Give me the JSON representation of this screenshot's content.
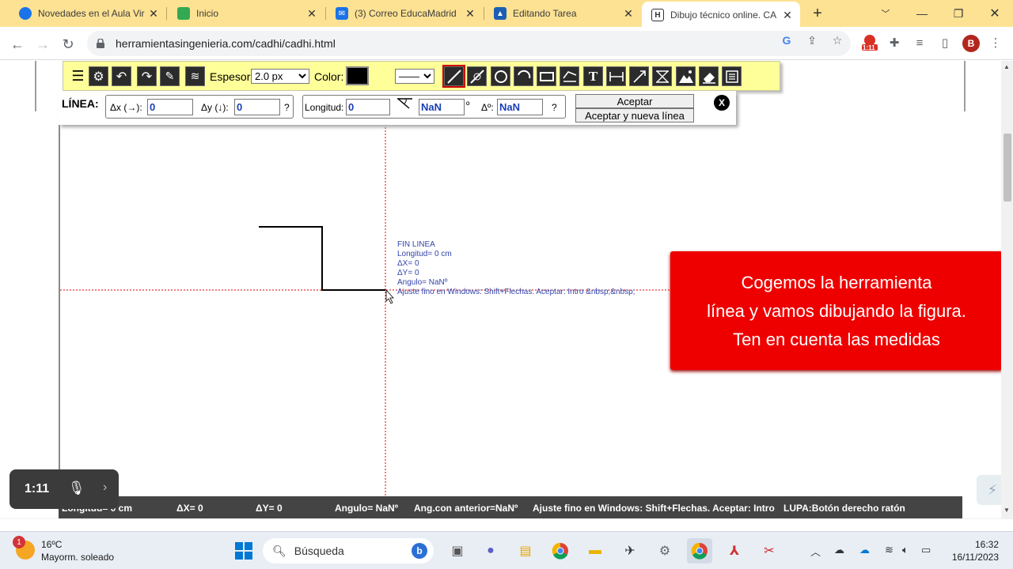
{
  "browser": {
    "tabs": [
      {
        "title": "Novedades en el Aula Vir",
        "favicon_color": "#1a73e8"
      },
      {
        "title": "Inicio",
        "favicon_color": "#34a853"
      },
      {
        "title": "(3) Correo EducaMadrid",
        "favicon_color": "#1a73e8"
      },
      {
        "title": "Editando Tarea",
        "favicon_color": "#1a5fb4"
      },
      {
        "title": "Dibujo técnico online. CA",
        "favicon_color": "#333333"
      }
    ],
    "url": "herramientasingenieria.com/cadhi/cadhi.html",
    "profile_initial": "B",
    "extension_badge": "1:11"
  },
  "cad_toolbar": {
    "grosor_label": "Espesor:",
    "grosor_value": "2.0 px",
    "color_label": "Color:",
    "color_value": "#000000",
    "linetype_value": "——"
  },
  "line_panel": {
    "title": "LÍNEA:",
    "dx_label": "Δx (→):",
    "dx_value": "0",
    "dy_label": "Δy (↓):",
    "dy_value": "0",
    "help": "?",
    "length_label": "Longitud:",
    "length_value": "0",
    "angle_value": "NaN",
    "degree_symbol": "º",
    "delta_angle_label": "Δº:",
    "delta_angle_value": "NaN",
    "accept_label": "Aceptar",
    "accept_new_label": "Aceptar y nueva línea",
    "close_label": "X"
  },
  "cursor_info": {
    "line1": "FIN LINEA",
    "line2": "Longitud= 0 cm",
    "line3": "ΔX= 0",
    "line4": "ΔY= 0",
    "line5": "Angulo= NaNº",
    "line6": "Ajuste fino en Windows: Shift+Flechas. Aceptar: Intro   &nbsp;&nbsp;"
  },
  "callout": {
    "line1": "Cogemos la herramienta",
    "line2": "línea y vamos dibujando la figura.",
    "line3": "Ten en cuenta las medidas",
    "color": "#ee0000"
  },
  "status_bar": {
    "length": "Longitud= 0 cm",
    "dx": "ΔX= 0",
    "dy": "ΔY= 0",
    "angle": "Angulo= NaNº",
    "prev_angle": "Ang.con anterior=NaNº",
    "hint": "Ajuste fino en Windows: Shift+Flechas. Aceptar: Intro",
    "lupa": "LUPA:Botón derecho ratón"
  },
  "video_overlay": {
    "time": "1:11"
  },
  "taskbar": {
    "weather_temp": "16ºC",
    "weather_desc": "Mayorm. soleado",
    "weather_badge": "1",
    "search_placeholder": "Búsqueda",
    "time": "16:32",
    "date": "16/11/2023"
  }
}
